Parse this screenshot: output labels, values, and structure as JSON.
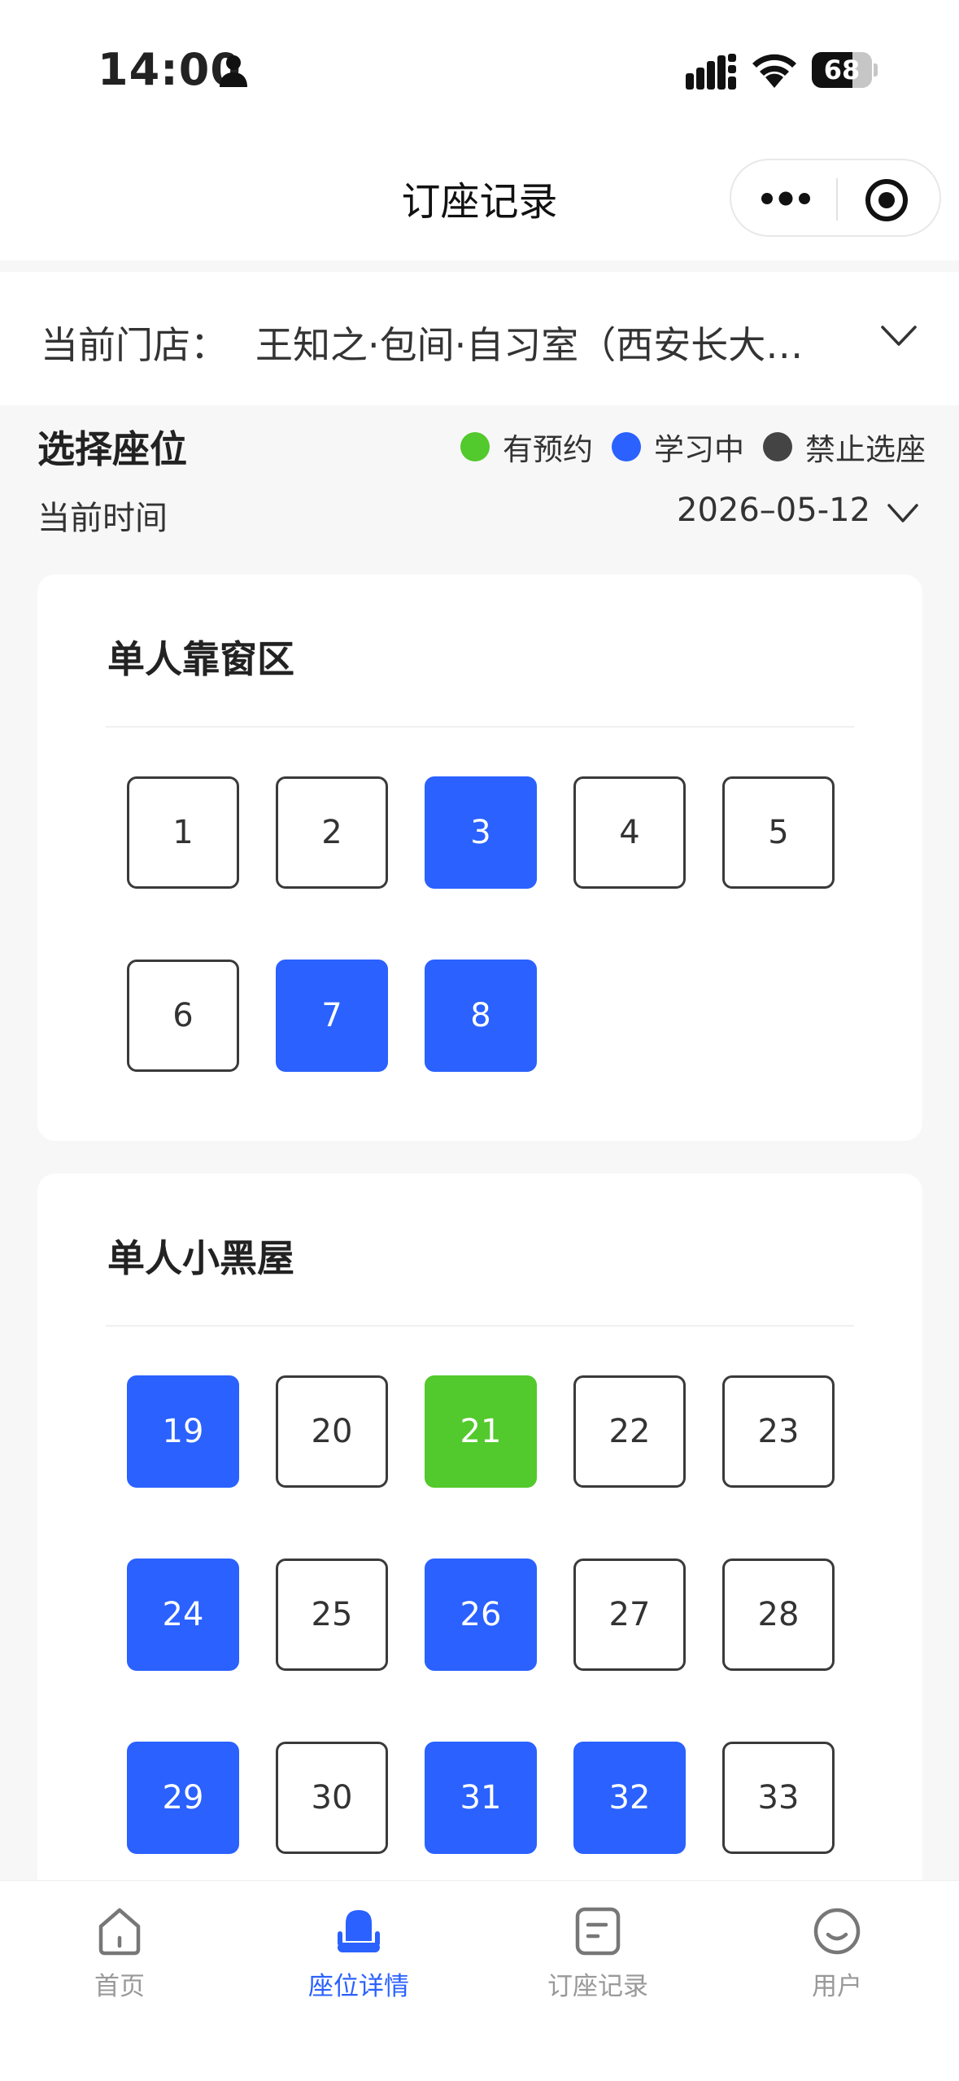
{
  "status_bar": {
    "time": "14:00",
    "battery": "68",
    "battery_level": 0.68
  },
  "nav": {
    "title": "订座记录"
  },
  "store": {
    "label": "当前门店：",
    "name": "王知之·包间·自习室（西安长大…"
  },
  "seat_select": {
    "title": "选择座位",
    "legend": [
      {
        "label": "有预约",
        "color": "#52c92c"
      },
      {
        "label": "学习中",
        "color": "#2a61ff"
      },
      {
        "label": "禁止选座",
        "color": "#444444"
      }
    ],
    "time_label": "当前时间",
    "date": "2026–05-12"
  },
  "zones": [
    {
      "name": "单人靠窗区",
      "seats": [
        {
          "num": "1",
          "status": "free"
        },
        {
          "num": "2",
          "status": "free"
        },
        {
          "num": "3",
          "status": "studying"
        },
        {
          "num": "4",
          "status": "free"
        },
        {
          "num": "5",
          "status": "free"
        },
        {
          "num": "6",
          "status": "free"
        },
        {
          "num": "7",
          "status": "studying"
        },
        {
          "num": "8",
          "status": "studying"
        }
      ]
    },
    {
      "name": "单人小黑屋",
      "seats": [
        {
          "num": "19",
          "status": "studying"
        },
        {
          "num": "20",
          "status": "free"
        },
        {
          "num": "21",
          "status": "reserved"
        },
        {
          "num": "22",
          "status": "free"
        },
        {
          "num": "23",
          "status": "free"
        },
        {
          "num": "24",
          "status": "studying"
        },
        {
          "num": "25",
          "status": "free"
        },
        {
          "num": "26",
          "status": "studying"
        },
        {
          "num": "27",
          "status": "free"
        },
        {
          "num": "28",
          "status": "free"
        },
        {
          "num": "29",
          "status": "studying"
        },
        {
          "num": "30",
          "status": "free"
        },
        {
          "num": "31",
          "status": "studying"
        },
        {
          "num": "32",
          "status": "studying"
        },
        {
          "num": "33",
          "status": "free"
        }
      ]
    }
  ],
  "tabs": [
    {
      "label": "首页",
      "icon": "home-icon",
      "active": false
    },
    {
      "label": "座位详情",
      "icon": "seat-icon",
      "active": true
    },
    {
      "label": "订座记录",
      "icon": "record-icon",
      "active": false
    },
    {
      "label": "用户",
      "icon": "user-icon",
      "active": false
    }
  ]
}
